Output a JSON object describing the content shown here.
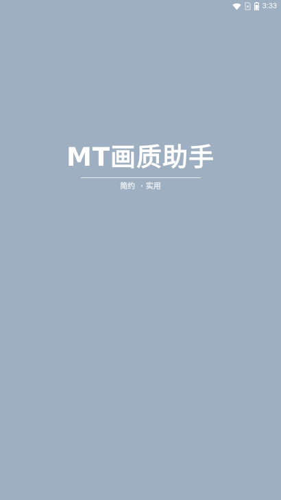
{
  "status_bar": {
    "time": "3:33",
    "icons": [
      "wifi-icon",
      "no-sim-icon",
      "battery-icon"
    ]
  },
  "splash": {
    "title": "MT画质助手",
    "tagline": "简约  · 实用"
  },
  "colors": {
    "background": "#9dafc0",
    "text": "#ffffff",
    "divider": "#e6ebf0"
  }
}
